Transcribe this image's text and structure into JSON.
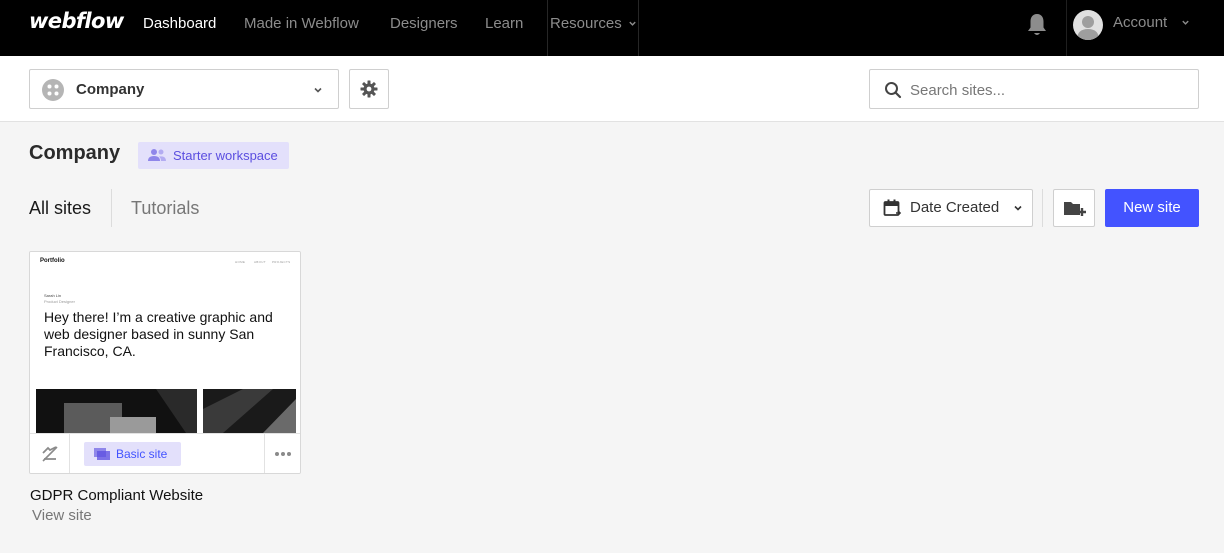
{
  "brand": {
    "logo_text": "webflow"
  },
  "nav": {
    "items": [
      "Dashboard",
      "Made in Webflow",
      "Designers",
      "Learn",
      "Resources"
    ],
    "active": "Dashboard",
    "account_label": "Account"
  },
  "toolbar": {
    "workspace_name": "Company",
    "search_placeholder": "Search sites..."
  },
  "workspace": {
    "title": "Company",
    "plan_badge": "Starter workspace"
  },
  "tabs": {
    "items": [
      "All sites",
      "Tutorials"
    ],
    "active": "All sites"
  },
  "actions": {
    "sort_label": "Date Created",
    "new_site_label": "New site"
  },
  "sites": [
    {
      "name": "GDPR Compliant Website",
      "view_label": "View site",
      "plan": "Basic site",
      "thumbnail": {
        "logo": "Portfolio",
        "nav": [
          "HOME",
          "ABOUT",
          "PROJECTS"
        ],
        "author_name": "Sarah Lin",
        "author_role": "Product Designer",
        "headline": "Hey there! I’m a creative graphic and web designer based in sunny San Francisco, CA."
      }
    }
  ],
  "colors": {
    "accent": "#4353ff",
    "badge_bg": "#e3e0fb",
    "badge_text": "#5b4ee0",
    "nav_bg": "#000000",
    "page_bg": "#f5f5f5"
  },
  "icons": [
    "bell-icon",
    "avatar-icon",
    "chevron-down-icon",
    "workspace-icon",
    "gear-icon",
    "search-icon",
    "users-icon",
    "calendar-icon",
    "folder-add-icon",
    "unpublished-icon",
    "plan-icon",
    "more-icon"
  ]
}
